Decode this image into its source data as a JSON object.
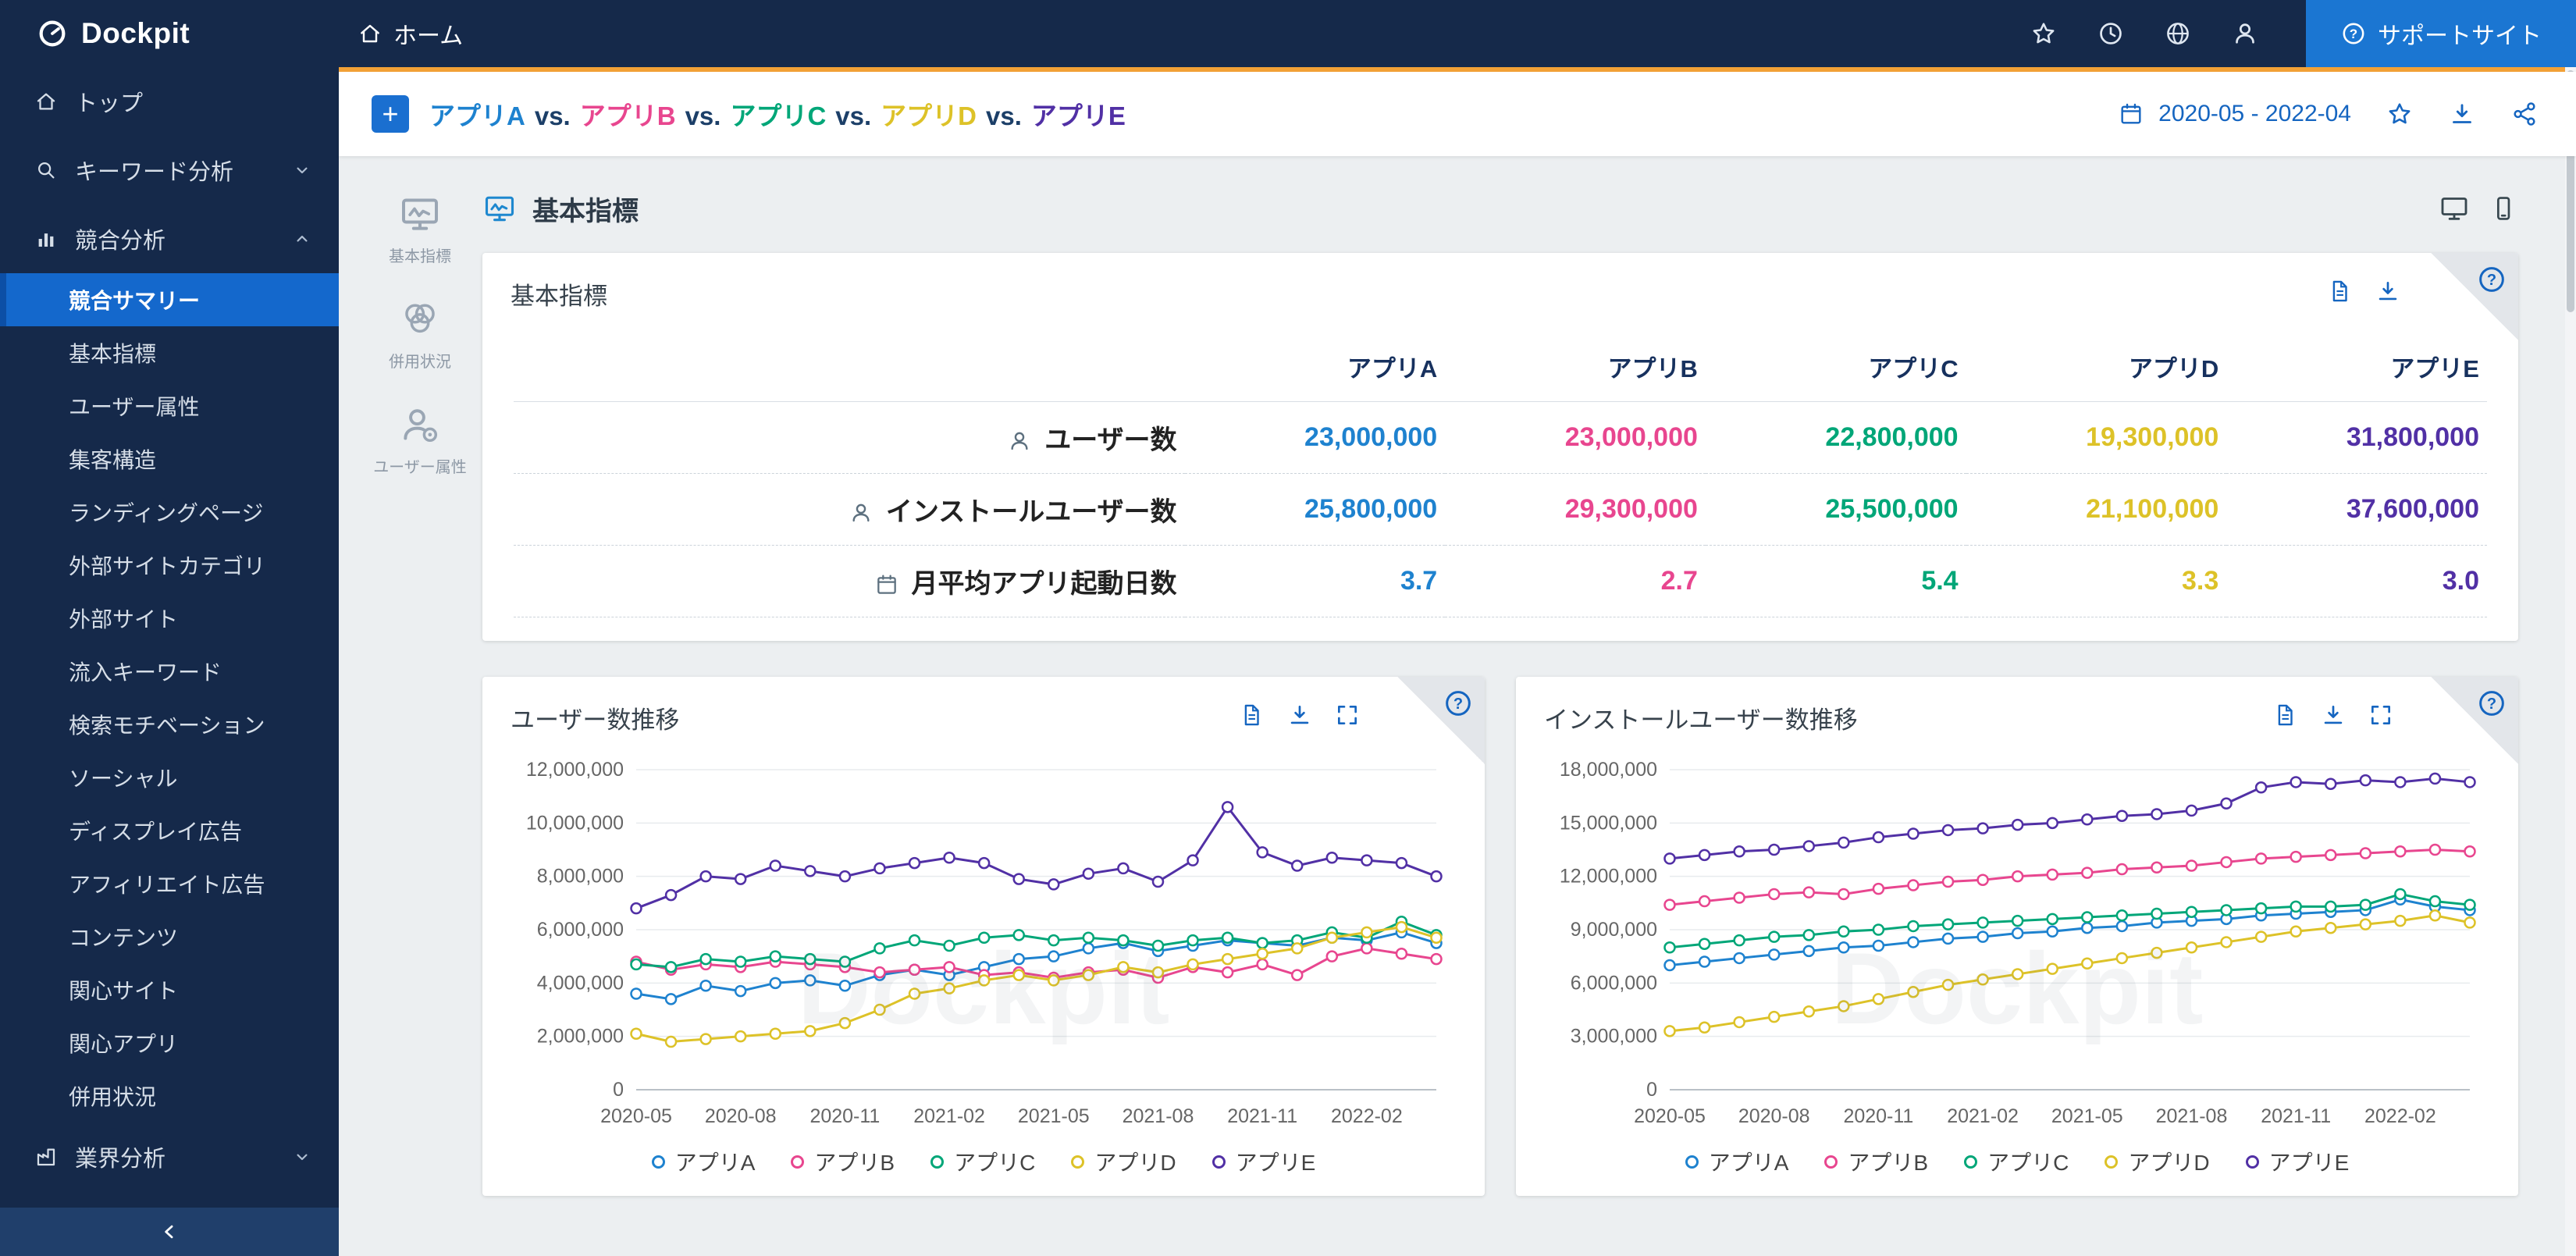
{
  "app": {
    "brand": "Dockpit",
    "home_label": "ホーム",
    "support_label": "サポートサイト"
  },
  "header": {
    "vs": "vs.",
    "date_range": "2020-05 - 2022-04"
  },
  "apps": [
    {
      "name": "アプリA",
      "color": "#1e82cf"
    },
    {
      "name": "アプリB",
      "color": "#e8468f"
    },
    {
      "name": "アプリC",
      "color": "#00a678"
    },
    {
      "name": "アプリD",
      "color": "#ddc228"
    },
    {
      "name": "アプリE",
      "color": "#5130a5"
    }
  ],
  "sidebar": {
    "top": {
      "label": "トップ"
    },
    "keyword": {
      "label": "キーワード分析"
    },
    "competitive": {
      "label": "競合分析",
      "selected": "競合サマリー",
      "items": [
        "競合サマリー",
        "基本指標",
        "ユーザー属性",
        "集客構造",
        "ランディングページ",
        "外部サイトカテゴリ",
        "外部サイト",
        "流入キーワード",
        "検索モチベーション",
        "ソーシャル",
        "ディスプレイ広告",
        "アフィリエイト広告",
        "コンテンツ",
        "関心サイト",
        "関心アプリ",
        "併用状況"
      ]
    },
    "industry": {
      "label": "業界分析"
    }
  },
  "rail": {
    "items": [
      {
        "label": "基本指標"
      },
      {
        "label": "併用状況"
      },
      {
        "label": "ユーザー属性"
      }
    ]
  },
  "section": {
    "title": "基本指標"
  },
  "metrics_card": {
    "title": "基本指標",
    "rows": [
      {
        "label": "ユーザー数",
        "values": [
          "23,000,000",
          "23,000,000",
          "22,800,000",
          "19,300,000",
          "31,800,000"
        ]
      },
      {
        "label": "インストールユーザー数",
        "values": [
          "25,800,000",
          "29,300,000",
          "25,500,000",
          "21,100,000",
          "37,600,000"
        ]
      },
      {
        "label": "月平均アプリ起動日数",
        "values": [
          "3.7",
          "2.7",
          "5.4",
          "3.3",
          "3.0"
        ]
      }
    ]
  },
  "chart_data": [
    {
      "type": "line",
      "title": "ユーザー数推移",
      "xlabel": "",
      "ylabel": "",
      "grid": true,
      "legend_position": "bottom",
      "ylim": [
        0,
        12000000
      ],
      "y_tick_step": 2000000,
      "x": [
        "2020-05",
        "2020-06",
        "2020-07",
        "2020-08",
        "2020-09",
        "2020-10",
        "2020-11",
        "2020-12",
        "2021-01",
        "2021-02",
        "2021-03",
        "2021-04",
        "2021-05",
        "2021-06",
        "2021-07",
        "2021-08",
        "2021-09",
        "2021-10",
        "2021-11",
        "2021-12",
        "2022-01",
        "2022-02",
        "2022-03",
        "2022-04"
      ],
      "x_tick_every": 3,
      "series": [
        {
          "name": "アプリA",
          "color": "#1e82cf",
          "values": [
            3600000,
            3400000,
            3900000,
            3700000,
            4000000,
            4100000,
            3900000,
            4300000,
            4500000,
            4300000,
            4600000,
            4900000,
            5000000,
            5300000,
            5500000,
            5200000,
            5400000,
            5600000,
            5500000,
            5400000,
            5700000,
            5600000,
            5900000,
            5500000
          ]
        },
        {
          "name": "アプリB",
          "color": "#e8468f",
          "values": [
            4800000,
            4500000,
            4700000,
            4600000,
            4800000,
            4700000,
            4600000,
            4400000,
            4500000,
            4600000,
            4300000,
            4400000,
            4200000,
            4400000,
            4500000,
            4200000,
            4600000,
            4400000,
            4700000,
            4300000,
            5000000,
            5300000,
            5100000,
            4900000
          ]
        },
        {
          "name": "アプリC",
          "color": "#00a678",
          "values": [
            4700000,
            4600000,
            4900000,
            4800000,
            5000000,
            4900000,
            4800000,
            5300000,
            5600000,
            5400000,
            5700000,
            5800000,
            5600000,
            5700000,
            5600000,
            5400000,
            5600000,
            5700000,
            5500000,
            5600000,
            5900000,
            5700000,
            6300000,
            5800000
          ]
        },
        {
          "name": "アプリD",
          "color": "#ddc228",
          "values": [
            2100000,
            1800000,
            1900000,
            2000000,
            2100000,
            2200000,
            2500000,
            3000000,
            3600000,
            3800000,
            4100000,
            4300000,
            4100000,
            4300000,
            4600000,
            4400000,
            4700000,
            4900000,
            5100000,
            5300000,
            5700000,
            5900000,
            6100000,
            5700000
          ]
        },
        {
          "name": "アプリE",
          "color": "#5130a5",
          "values": [
            6800000,
            7300000,
            8000000,
            7900000,
            8400000,
            8200000,
            8000000,
            8300000,
            8500000,
            8700000,
            8500000,
            7900000,
            7700000,
            8100000,
            8300000,
            7800000,
            8600000,
            10600000,
            8900000,
            8400000,
            8700000,
            8600000,
            8500000,
            8000000
          ]
        }
      ]
    },
    {
      "type": "line",
      "title": "インストールユーザー数推移",
      "xlabel": "",
      "ylabel": "",
      "grid": true,
      "legend_position": "bottom",
      "ylim": [
        0,
        18000000
      ],
      "y_tick_step": 3000000,
      "x": [
        "2020-05",
        "2020-06",
        "2020-07",
        "2020-08",
        "2020-09",
        "2020-10",
        "2020-11",
        "2020-12",
        "2021-01",
        "2021-02",
        "2021-03",
        "2021-04",
        "2021-05",
        "2021-06",
        "2021-07",
        "2021-08",
        "2021-09",
        "2021-10",
        "2021-11",
        "2021-12",
        "2022-01",
        "2022-02",
        "2022-03",
        "2022-04"
      ],
      "x_tick_every": 3,
      "series": [
        {
          "name": "アプリA",
          "color": "#1e82cf",
          "values": [
            7000000,
            7200000,
            7400000,
            7600000,
            7800000,
            8000000,
            8100000,
            8300000,
            8500000,
            8600000,
            8800000,
            8900000,
            9100000,
            9200000,
            9400000,
            9500000,
            9600000,
            9800000,
            9900000,
            10000000,
            10100000,
            10700000,
            10300000,
            10100000
          ]
        },
        {
          "name": "アプリB",
          "color": "#e8468f",
          "values": [
            10400000,
            10600000,
            10800000,
            11000000,
            11100000,
            11000000,
            11300000,
            11500000,
            11700000,
            11800000,
            12000000,
            12100000,
            12200000,
            12400000,
            12500000,
            12600000,
            12800000,
            13000000,
            13100000,
            13200000,
            13300000,
            13400000,
            13500000,
            13400000
          ]
        },
        {
          "name": "アプリC",
          "color": "#00a678",
          "values": [
            8000000,
            8200000,
            8400000,
            8600000,
            8700000,
            8900000,
            9000000,
            9200000,
            9300000,
            9400000,
            9500000,
            9600000,
            9700000,
            9800000,
            9900000,
            10000000,
            10100000,
            10200000,
            10300000,
            10300000,
            10400000,
            11000000,
            10600000,
            10400000
          ]
        },
        {
          "name": "アプリD",
          "color": "#ddc228",
          "values": [
            3300000,
            3500000,
            3800000,
            4100000,
            4400000,
            4700000,
            5100000,
            5500000,
            5900000,
            6200000,
            6500000,
            6800000,
            7100000,
            7400000,
            7700000,
            8000000,
            8300000,
            8600000,
            8900000,
            9100000,
            9300000,
            9500000,
            9800000,
            9400000
          ]
        },
        {
          "name": "アプリE",
          "color": "#5130a5",
          "values": [
            13000000,
            13200000,
            13400000,
            13500000,
            13700000,
            13900000,
            14200000,
            14400000,
            14600000,
            14700000,
            14900000,
            15000000,
            15200000,
            15400000,
            15500000,
            15700000,
            16100000,
            17000000,
            17300000,
            17200000,
            17400000,
            17300000,
            17500000,
            17300000
          ]
        }
      ]
    }
  ]
}
